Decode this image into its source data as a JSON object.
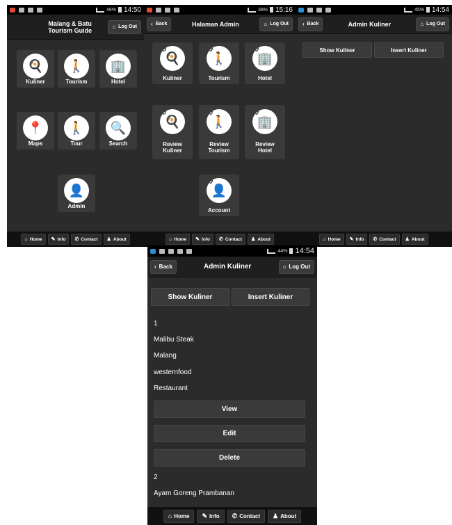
{
  "screens": [
    {
      "status": {
        "pct": "46%",
        "time": "14:50"
      },
      "header": {
        "title_line1": "Malang & Batu",
        "title_line2": "Tourism Guide",
        "logout": "Log Out"
      },
      "tiles": [
        {
          "label": "Kuliner",
          "icon": "chef-hat-icon",
          "glyph": "🍳"
        },
        {
          "label": "Tourism",
          "icon": "hiker-icon",
          "glyph": "🚶"
        },
        {
          "label": "Hotel",
          "icon": "building-icon",
          "glyph": "🏢"
        },
        {
          "label": "Maps",
          "icon": "map-pin-icon",
          "glyph": "📍"
        },
        {
          "label": "Tour",
          "icon": "walker-icon",
          "glyph": "🚶"
        },
        {
          "label": "Search",
          "icon": "magnifier-icon",
          "glyph": "🔍"
        },
        {
          "label": "Admin",
          "icon": "admin-user-icon",
          "glyph": "👤"
        }
      ]
    },
    {
      "status": {
        "pct": "39%",
        "time": "15:16"
      },
      "header": {
        "back": "Back",
        "title": "Halaman Admin",
        "logout": "Log Out"
      },
      "tiles": [
        {
          "label1": "Kuliner",
          "label2": "",
          "icon": "chef-hat-gear-icon",
          "glyph": "🍳"
        },
        {
          "label1": "Tourism",
          "label2": "",
          "icon": "hiker-gear-icon",
          "glyph": "🚶"
        },
        {
          "label1": "Hotel",
          "label2": "",
          "icon": "building-gear-icon",
          "glyph": "🏢"
        },
        {
          "label1": "Review",
          "label2": "Kuliner",
          "icon": "review-kuliner-icon",
          "glyph": "🍳"
        },
        {
          "label1": "Review",
          "label2": "Tourism",
          "icon": "review-tourism-icon",
          "glyph": "🚶"
        },
        {
          "label1": "Review",
          "label2": "Hotel",
          "icon": "review-hotel-icon",
          "glyph": "🏢"
        },
        {
          "label1": "Account",
          "label2": "",
          "icon": "account-gear-icon",
          "glyph": "👤"
        }
      ]
    },
    {
      "status": {
        "pct": "45%",
        "time": "14:54"
      },
      "header": {
        "back": "Back",
        "title": "Admin Kuliner",
        "logout": "Log Out"
      },
      "show": "Show Kuliner",
      "insert": "Insert Kuliner"
    },
    {
      "status": {
        "pct": "44%",
        "time": "14:54"
      },
      "header": {
        "back": "Back",
        "title": "Admin Kuliner",
        "logout": "Log Out"
      },
      "show": "Show Kuliner",
      "insert": "Insert Kuliner",
      "record1": {
        "id": "1",
        "name": "Malibu Steak",
        "city": "Malang",
        "category": "westernfood",
        "type": "Restaurant"
      },
      "actions": {
        "view": "View",
        "edit": "Edit",
        "delete": "Delete"
      },
      "record2": {
        "id": "2",
        "name": "Ayam Goreng Prambanan"
      }
    }
  ],
  "footer": {
    "home": "Home",
    "info": "Info",
    "contact": "Contact",
    "about": "About"
  },
  "glyphs": {
    "home": "⌂",
    "info": "✎",
    "contact": "✆",
    "about": "♟",
    "back": "‹",
    "gear": "⚙"
  }
}
